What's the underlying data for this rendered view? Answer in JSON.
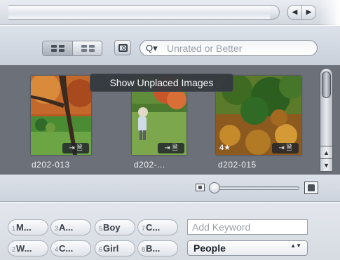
{
  "top": {
    "nav_left": "◀",
    "nav_right": "▶"
  },
  "toolbar": {
    "view_grid_icon": "grid-view-icon",
    "view_list_icon": "filmstrip-view-icon",
    "loupe_icon": "loupe-icon",
    "search_glyph": "Q▾",
    "search_placeholder": "Unrated or Better"
  },
  "browser": {
    "tooltip": "Show Unplaced Images",
    "images": [
      {
        "label": "d202-013",
        "rating": "",
        "badge": "⇥ 🗎"
      },
      {
        "label": "d202-...",
        "rating": "",
        "badge": "⇥ 🗎"
      },
      {
        "label": "d202-015",
        "rating": "4★",
        "badge": "⇥ 🗎"
      }
    ],
    "scroll_up": "▲",
    "scroll_down": "▼"
  },
  "zoom": {
    "small_icon": "small-thumbnail-icon",
    "large_icon": "large-thumbnail-icon",
    "level": 0.05
  },
  "keywords": {
    "buttons": [
      {
        "num": "1",
        "label": "M..."
      },
      {
        "num": "3",
        "label": "A..."
      },
      {
        "num": "5",
        "label": "Boy"
      },
      {
        "num": "7",
        "label": "C..."
      },
      {
        "num": "2",
        "label": "W..."
      },
      {
        "num": "4",
        "label": "C..."
      },
      {
        "num": "6",
        "label": "Girl"
      },
      {
        "num": "8",
        "label": "B..."
      }
    ],
    "input_placeholder": "Add Keyword",
    "set_selected": "People",
    "set_arrows": "▲▼"
  }
}
